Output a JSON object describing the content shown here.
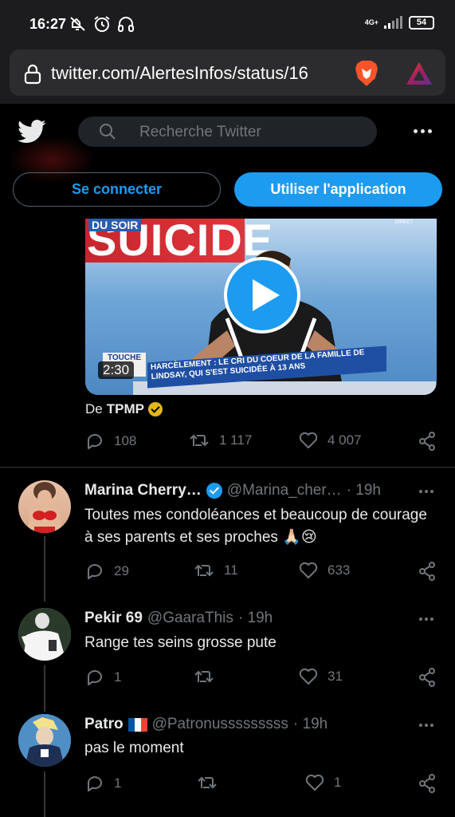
{
  "status_bar": {
    "time": "16:27",
    "network": "4G+",
    "battery": "54",
    "icons": [
      "mute-icon",
      "alarm-icon",
      "headset-icon",
      "signal-icon",
      "battery-icon"
    ]
  },
  "browser": {
    "url": "twitter.com/AlertesInfos/status/16",
    "icons": [
      "lock-icon",
      "brave-shield-icon",
      "brave-rewards-icon"
    ]
  },
  "twitter": {
    "search_placeholder": "Recherche Twitter",
    "login_label": "Se connecter",
    "app_label": "Utiliser l'application",
    "accent": "#1d9bf0"
  },
  "video": {
    "banner_small": "DU SOIR",
    "banner_title": "SUICIDE",
    "live": "DIRECT",
    "show_tag": "TOUCHE",
    "lower_third": "HARCÈLEMENT : LE CRI DU COEUR DE LA FAMILLE DE LINDSAY, QUI S'EST SUICIDÉE À 13 ANS",
    "duration": "2:30"
  },
  "source": {
    "prefix": "De",
    "name": "TPMP"
  },
  "main_actions": {
    "replies": "108",
    "retweets": "1 117",
    "likes": "4 007"
  },
  "replies": [
    {
      "name": "Marina Cherry…",
      "handle": "@Marina_cher…",
      "time": "· 19h",
      "verified": true,
      "text": "Toutes mes condoléances et beaucoup de courage à ses parents et ses proches 🙏🏻😢",
      "replies": "29",
      "retweets": "11",
      "likes": "633"
    },
    {
      "name": "Pekir 69",
      "handle": "@GaaraThis",
      "time": "· 19h",
      "verified": false,
      "text": "Range tes seins grosse pute",
      "replies": "1",
      "retweets": "",
      "likes": "31"
    },
    {
      "name": "Patro",
      "handle": "@Patronusssssssss",
      "time": "· 19h",
      "verified": false,
      "text": "pas le moment",
      "replies": "1",
      "retweets": "",
      "likes": "1"
    }
  ]
}
